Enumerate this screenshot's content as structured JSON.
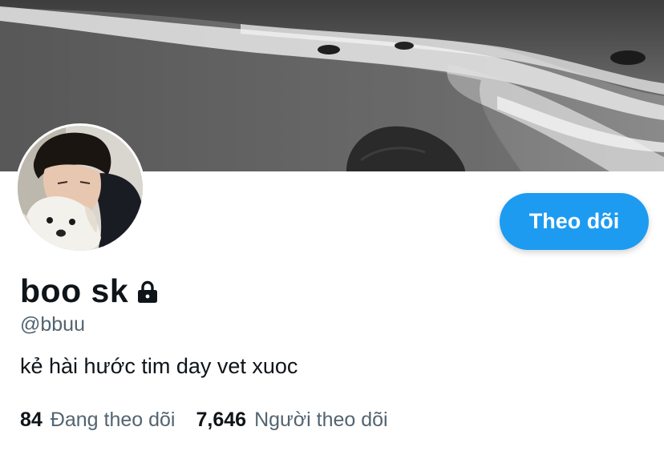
{
  "profile": {
    "display_name": "boo sk",
    "handle": "@bbuu",
    "bio": "kẻ hài hước tim day vet xuoc",
    "protected_icon": "lock-icon",
    "avatar_description": "profile-photo",
    "banner_description": "black-and-white-beach-photo"
  },
  "actions": {
    "follow_label": "Theo dõi"
  },
  "stats": {
    "following_count": "84",
    "following_label": "Đang theo dõi",
    "followers_count": "7,646",
    "followers_label": "Người theo dõi"
  },
  "colors": {
    "accent": "#1d9bf0",
    "text_primary": "#0f1419",
    "text_secondary": "#536471"
  }
}
